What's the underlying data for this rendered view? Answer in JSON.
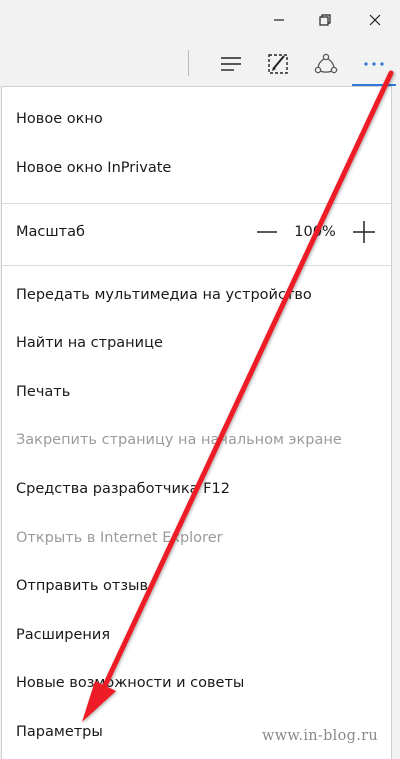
{
  "titlebar": {
    "icons": [
      "minimize-icon",
      "restore-icon",
      "close-icon"
    ]
  },
  "toolbar": {
    "icons": [
      "hub-icon",
      "web-note-icon",
      "share-icon",
      "more-icon"
    ],
    "accent_color": "#2b79d9"
  },
  "menu": {
    "new_window": "Новое окно",
    "new_inprivate": "Новое окно InPrivate",
    "zoom_label": "Масштаб",
    "zoom_value": "100%",
    "cast_media": "Передать мультимедиа на устройство",
    "find_on_page": "Найти на странице",
    "print": "Печать",
    "pin_to_start": "Закрепить страницу на начальном экране",
    "dev_tools": "Средства разработчика F12",
    "open_in_ie": "Открыть в Internet Explorer",
    "send_feedback": "Отправить отзыв",
    "extensions": "Расширения",
    "whats_new": "Новые возможности и советы",
    "settings": "Параметры"
  },
  "annotation": {
    "arrow_color": "#ee1c25"
  },
  "watermark": "www.in-blog.ru"
}
